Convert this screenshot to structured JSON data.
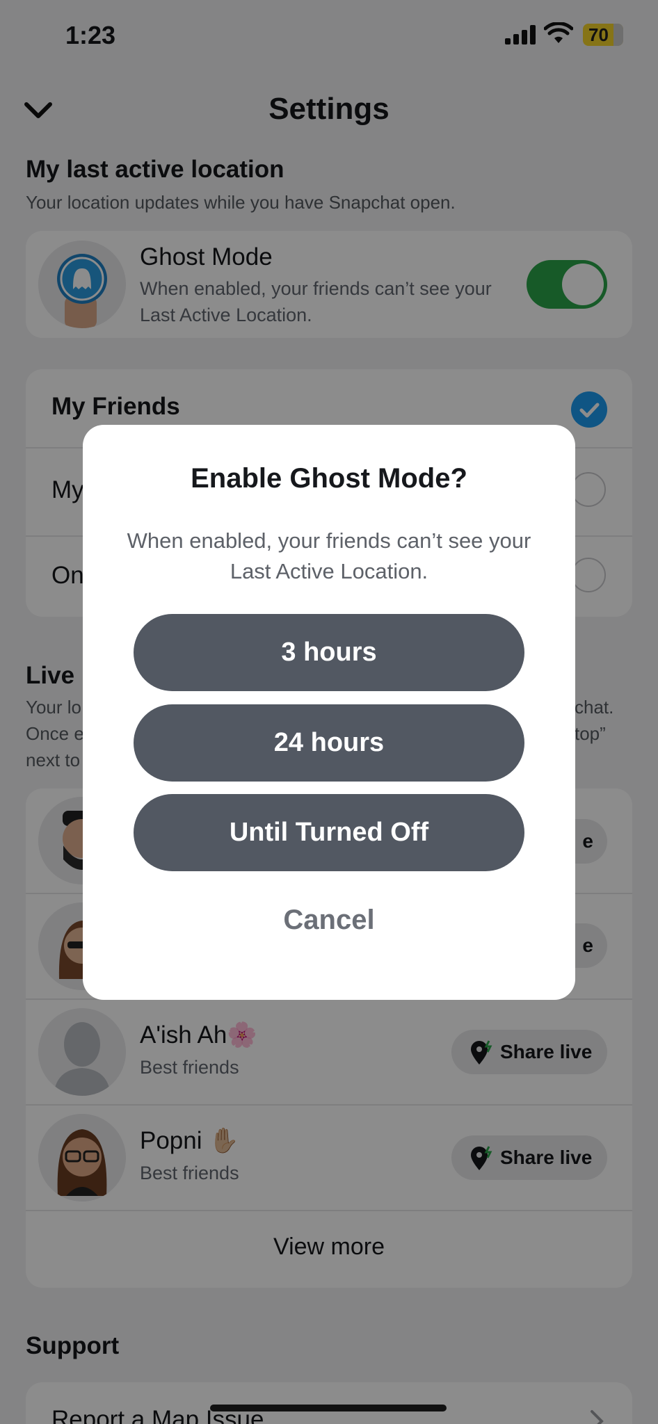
{
  "status_bar": {
    "time": "1:23",
    "battery": "70"
  },
  "header": {
    "title": "Settings"
  },
  "last_active": {
    "title": "My last active location",
    "subtitle": "Your location updates while you have Snapchat open.",
    "ghost_mode": {
      "title": "Ghost Mode",
      "subtitle": "When enabled, your friends can’t see your Last Active Location.",
      "enabled": true
    }
  },
  "audience": {
    "options": [
      {
        "label": "My Friends",
        "selected": true
      },
      {
        "label": "My",
        "selected": false
      },
      {
        "label": "On",
        "selected": false
      }
    ]
  },
  "live": {
    "title": "Live l",
    "subtitle_lines": [
      "Your lo",
      "Once e",
      "next to"
    ],
    "subtitle_right": [
      "chat.",
      "top”"
    ],
    "friends": [
      {
        "name": "",
        "sub": "",
        "button": "e"
      },
      {
        "name": "",
        "sub": "",
        "button": "e"
      },
      {
        "name": "A'ish Ah🌸",
        "sub": "Best friends",
        "button": "Share live"
      },
      {
        "name": "Popni ✋🏼",
        "sub": "Best friends",
        "button": "Share live"
      }
    ],
    "view_more": "View more"
  },
  "support": {
    "title": "Support",
    "item": "Report a Map Issue"
  },
  "modal": {
    "title": "Enable Ghost Mode?",
    "body": "When enabled, your friends can’t see your Last Active Location.",
    "options": [
      "3 hours",
      "24 hours",
      "Until Turned Off"
    ],
    "cancel": "Cancel"
  },
  "colors": {
    "accent_green": "#2aa44a",
    "check_blue": "#1d9bf0",
    "modal_button": "#525862"
  }
}
